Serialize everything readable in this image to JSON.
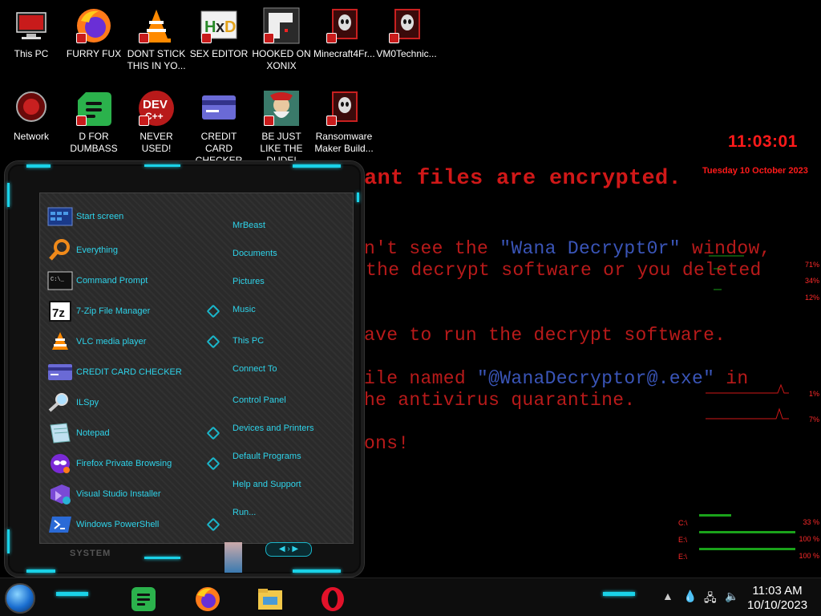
{
  "desktop_icons": [
    {
      "label": "This PC"
    },
    {
      "label": "FURRY FUX"
    },
    {
      "label": "DONT STICK THIS IN YO..."
    },
    {
      "label": "SEX EDITOR"
    },
    {
      "label": "HOOKED ON XONIX"
    },
    {
      "label": "Minecraft4Fr..."
    },
    {
      "label": "VM0Technic..."
    },
    {
      "label": "Network"
    },
    {
      "label": "D FOR DUMBASS"
    },
    {
      "label": "NEVER USED!"
    },
    {
      "label": "CREDIT CARD CHECKER"
    },
    {
      "label": "BE JUST LIKE THE DUDE!"
    },
    {
      "label": "Ransomware Maker Build..."
    }
  ],
  "ransom": {
    "line1": "ant files are encrypted.",
    "line2a": "n't see the ",
    "line2b": "\"Wana Decrypt0r\"",
    "line2c": " window,",
    "line3": "the decrypt software or you deleted",
    "line4": "ave to run the decrypt software.",
    "line5a": "ile named ",
    "line5b": "\"@WanaDecryptor@.exe\"",
    "line5c": " in",
    "line6": "he antivirus quarantine.",
    "line7": "ons!"
  },
  "widget": {
    "time": "11:03:01",
    "date": "Tuesday 10 October 2023",
    "cpu": [
      "71%",
      "34%",
      "12%"
    ],
    "net": [
      "1%",
      "7%"
    ],
    "drives": [
      {
        "label": "C:\\",
        "pct": "33 %",
        "fill": 0.33
      },
      {
        "label": "E:\\",
        "pct": "100 %",
        "fill": 1.0
      },
      {
        "label": "E:\\",
        "pct": "100 %",
        "fill": 1.0
      }
    ]
  },
  "start_menu": {
    "left": [
      "Start screen",
      "Everything",
      "Command Prompt",
      "7-Zip File Manager",
      "VLC media player",
      "CREDIT CARD CHECKER",
      "ILSpy",
      "Notepad",
      "Firefox Private Browsing",
      "Visual Studio Installer",
      "Windows PowerShell"
    ],
    "right": [
      "MrBeast",
      "Documents",
      "Pictures",
      "Music",
      "This PC",
      "Connect To",
      "Control Panel",
      "Devices and Printers",
      "Default Programs",
      "Help and Support",
      "Run..."
    ],
    "footer": "SYSTEM",
    "colors": {
      "accent": "#2ed3ea",
      "text_red": "#b81a1a"
    }
  },
  "taskbar": {
    "time": "11:03 AM",
    "date": "10/10/2023"
  }
}
